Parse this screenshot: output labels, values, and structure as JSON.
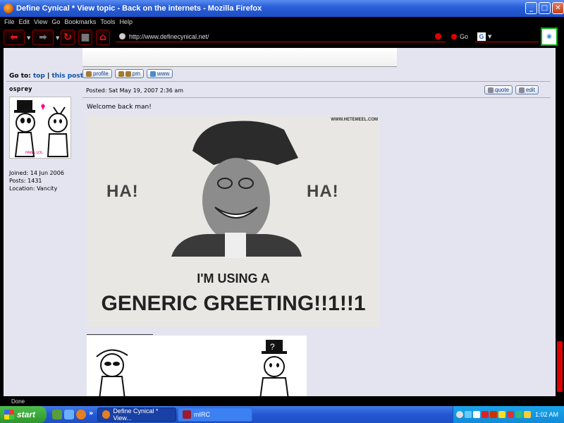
{
  "window": {
    "title": "Define Cynical * View topic - Back on the internets - Mozilla Firefox",
    "min_icon": "minimize-icon",
    "max_icon": "maximize-icon",
    "close_icon": "close-icon"
  },
  "menu": [
    "File",
    "Edit",
    "View",
    "Go",
    "Bookmarks",
    "Tools",
    "Help"
  ],
  "toolbar": {
    "url": "http://www.definecynical.net/",
    "go_label": "Go",
    "search_engine_icon": "G",
    "theme_color": "#cc0000"
  },
  "page": {
    "goto_label": "Go to:",
    "goto_top": "top",
    "goto_sep": "|",
    "goto_post": "this post",
    "profile_btn": "profile",
    "pm_btn": "pm",
    "www_btn": "www",
    "author": "osprey",
    "joined": "Joined: 14 Jun 2006",
    "posts": "Posts: 1431",
    "location": "Location: Vancity",
    "posted": "Posted: Sat May 19, 2007 2:36 am",
    "quote_btn": "quote",
    "edit_btn": "edit",
    "message": "Welcome back man!",
    "avatar_caption": "PAWS LOL",
    "meme": {
      "watermark": "WWW.HETEMEEL.COM",
      "ha_left": "HA!",
      "ha_right": "HA!",
      "line1": "I'M USING A",
      "line2": "GENERIC GREETING!!1!!1"
    }
  },
  "status": "Done",
  "taskbar": {
    "start": "start",
    "tasks": [
      "Define Cynical * View...",
      "mIRC"
    ],
    "clock": "1:02 AM",
    "expand": "»"
  }
}
